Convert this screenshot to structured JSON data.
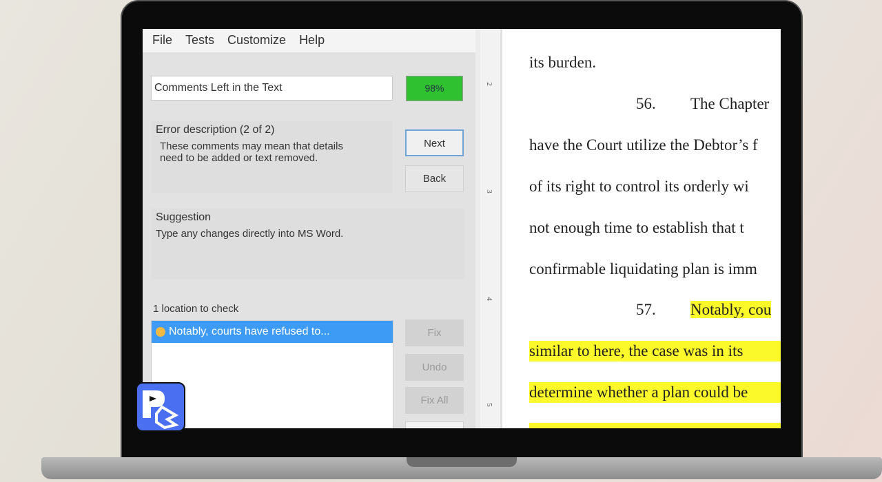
{
  "menu": [
    "File",
    "Tests",
    "Customize",
    "Help"
  ],
  "test_name": "Comments Left in the Text",
  "score": "98%",
  "error": {
    "title": "Error description (2 of 2)",
    "text_line1": "These comments may mean that details",
    "text_line2": "need to be added or text removed."
  },
  "buttons": {
    "next": "Next",
    "back": "Back",
    "fix": "Fix",
    "undo": "Undo",
    "fix_all": "Fix All"
  },
  "suggestion": {
    "title": "Suggestion",
    "text": "Type any changes directly into MS Word."
  },
  "locations": {
    "count_label": "1 location to check",
    "items": [
      "Notably, courts have refused to..."
    ]
  },
  "ruler": [
    "2",
    "3",
    "4",
    "5"
  ],
  "document": {
    "l1": "its burden.",
    "p56_num": "56.",
    "p56_start": "The Chapter",
    "l3": "have the Court utilize the Debtor’s f",
    "l4": "of its right to control its orderly wi",
    "l5": "not enough time to establish that t",
    "l6": "confirmable liquidating plan is imm",
    "p57_num": "57.",
    "p57_start": "Notably, cou",
    "l8": "similar to here, the case was in its",
    "l9": "determine whether a plan could be"
  },
  "colors": {
    "highlight": "#fbf92a",
    "selection": "#3d9bf6",
    "score": "#2fc12f"
  }
}
